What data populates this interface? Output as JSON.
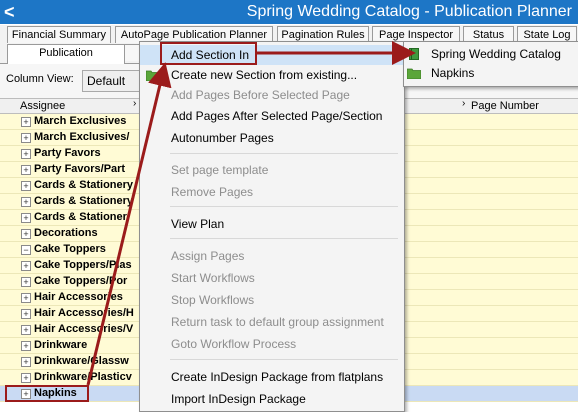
{
  "window": {
    "title": "Spring Wedding Catalog - Publication Planner",
    "back_glyph": "<"
  },
  "tabs_row1": [
    {
      "label": "Financial Summary"
    },
    {
      "label": "AutoPage Publication Planner"
    },
    {
      "label": "Pagination Rules"
    },
    {
      "label": "Page Inspector"
    },
    {
      "label": "Status"
    },
    {
      "label": "State Log"
    }
  ],
  "tabs_row2": [
    {
      "label": "Publication"
    }
  ],
  "toolbar": {
    "column_view_label": "Column View:",
    "column_view_value": "Default"
  },
  "grid": {
    "headers": [
      "Assignee",
      "Page Number"
    ],
    "rows": [
      {
        "label": "March Exclusives",
        "expander": "+"
      },
      {
        "label": "March Exclusives/",
        "expander": "+"
      },
      {
        "label": "Party Favors",
        "expander": "+"
      },
      {
        "label": "Party Favors/Part",
        "expander": "+"
      },
      {
        "label": "Cards & Stationery",
        "expander": "+"
      },
      {
        "label": "Cards & Stationery",
        "expander": "+"
      },
      {
        "label": "Cards & Stationer",
        "expander": "+"
      },
      {
        "label": "Decorations",
        "expander": "+"
      },
      {
        "label": "Cake Toppers",
        "expander": "−"
      },
      {
        "label": "Cake Toppers/Plas",
        "expander": "+"
      },
      {
        "label": "Cake Toppers/Por",
        "expander": "+"
      },
      {
        "label": "Hair Accessories",
        "expander": "+"
      },
      {
        "label": "Hair Accessories/H",
        "expander": "+"
      },
      {
        "label": "Hair Accessories/V",
        "expander": "+"
      },
      {
        "label": "Drinkware",
        "expander": "+"
      },
      {
        "label": "Drinkware/Glassw",
        "expander": "+"
      },
      {
        "label": "Drinkware/Plasticv",
        "expander": "+"
      },
      {
        "label": "Napkins",
        "expander": "+",
        "selected": true
      }
    ]
  },
  "context_menu": {
    "items": [
      {
        "label": "Add Section In",
        "enabled": true,
        "submenu": true,
        "highlighted": true
      },
      {
        "label": "Create new Section from existing...",
        "enabled": true,
        "icon": "folder-icon"
      },
      {
        "label": "Add Pages Before Selected Page",
        "enabled": false
      },
      {
        "label": "Add Pages After Selected Page/Section",
        "enabled": true
      },
      {
        "label": "Autonumber Pages",
        "enabled": true
      },
      {
        "label": "Set page template",
        "enabled": false
      },
      {
        "label": "Remove Pages",
        "enabled": false
      },
      {
        "label": "View Plan",
        "enabled": true
      },
      {
        "label": "Assign Pages",
        "enabled": false
      },
      {
        "label": "Start Workflows",
        "enabled": false
      },
      {
        "label": "Stop Workflows",
        "enabled": false
      },
      {
        "label": "Return task to default group assignment",
        "enabled": false
      },
      {
        "label": "Goto Workflow Process",
        "enabled": false
      },
      {
        "label": "Create InDesign Package from flatplans",
        "enabled": true
      },
      {
        "label": "Import InDesign Package",
        "enabled": true
      }
    ]
  },
  "submenu": {
    "items": [
      {
        "label": "Spring Wedding Catalog",
        "icon": "book-icon"
      },
      {
        "label": "Napkins",
        "icon": "folder-icon"
      }
    ]
  },
  "colors": {
    "titlebar": "#1d76c6",
    "row_bg": "#fffbd5",
    "selected_row": "#c9daf3",
    "annotation_red": "#9b1b1b"
  }
}
